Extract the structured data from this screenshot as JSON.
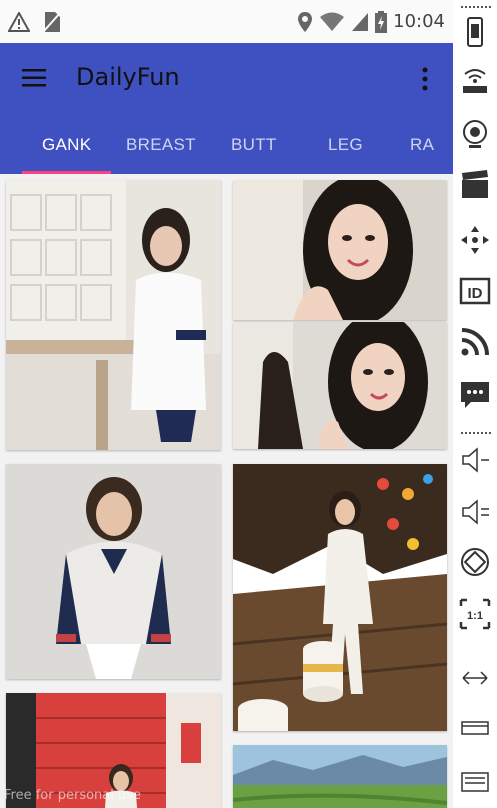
{
  "status_bar": {
    "time": "10:04",
    "left_icons": [
      "warning-icon",
      "no-sim-icon"
    ],
    "right_icons": [
      "location-icon",
      "wifi-icon",
      "signal-icon",
      "battery-icon"
    ]
  },
  "app_bar": {
    "title": "DailyFun",
    "menu_icon": "hamburger-menu-icon",
    "overflow_icon": "more-vert-icon",
    "color": "#3f51c0"
  },
  "tabs": [
    {
      "label": "GANK",
      "active": true
    },
    {
      "label": "BREAST",
      "active": false
    },
    {
      "label": "BUTT",
      "active": false
    },
    {
      "label": "LEG",
      "active": false
    },
    {
      "label": "RA",
      "active": false
    }
  ],
  "accent_color": "#ff4081",
  "photos": [
    {
      "name": "photo-girl-classroom",
      "column": "left"
    },
    {
      "name": "photo-girl-smiling-1",
      "column": "right"
    },
    {
      "name": "photo-girl-smiling-2",
      "column": "right"
    },
    {
      "name": "photo-girl-jacket",
      "column": "left"
    },
    {
      "name": "photo-girl-night-street",
      "column": "right"
    },
    {
      "name": "photo-girl-red-wall",
      "column": "left"
    },
    {
      "name": "photo-landscape-mountains",
      "column": "right"
    }
  ],
  "watermark": "Free for personal use",
  "emulator_sidebar": {
    "icons": [
      "phone-rotate-icon",
      "gps-icon",
      "camera-icon",
      "clapboard-icon",
      "dpad-icon",
      "id-icon",
      "rss-icon",
      "sms-icon",
      "volume-down-icon",
      "volume-up-icon",
      "rotate-icon",
      "scale-1to1-icon",
      "resize-icon",
      "screen-icon",
      "keyboard-icon"
    ]
  }
}
